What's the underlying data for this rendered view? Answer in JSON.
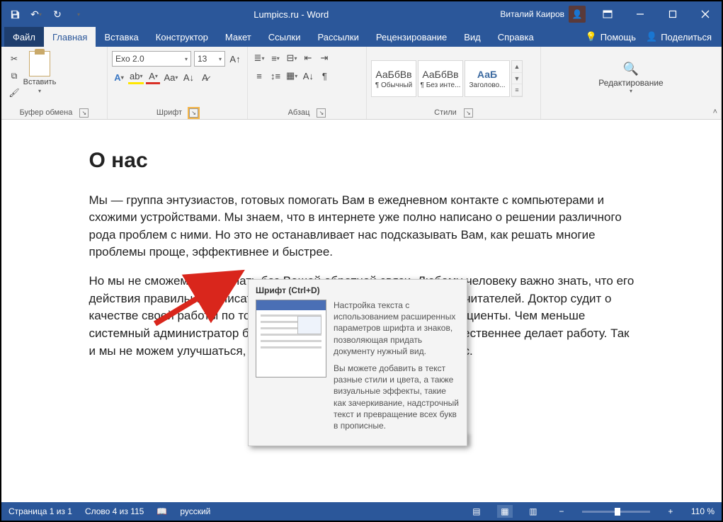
{
  "titlebar": {
    "doc_title": "Lumpics.ru  -  Word",
    "user_name": "Виталий Каиров"
  },
  "tabs": {
    "file": "Файл",
    "items": [
      "Главная",
      "Вставка",
      "Конструктор",
      "Макет",
      "Ссылки",
      "Рассылки",
      "Рецензирование",
      "Вид",
      "Справка"
    ],
    "help": "Помощь",
    "share": "Поделиться"
  },
  "ribbon": {
    "clipboard": {
      "paste": "Вставить",
      "label": "Буфер обмена"
    },
    "font": {
      "name": "Exo 2.0",
      "size": "13",
      "label": "Шрифт"
    },
    "paragraph": {
      "label": "Абзац"
    },
    "styles": {
      "label": "Стили",
      "tiles": [
        {
          "sample": "АаБбВв",
          "name": "¶ Обычный"
        },
        {
          "sample": "АаБбВв",
          "name": "¶ Без инте..."
        },
        {
          "sample": "АаБ",
          "name": "Заголово..."
        }
      ]
    },
    "editing": {
      "label": "Редактирование"
    }
  },
  "tooltip": {
    "title": "Шрифт (Ctrl+D)",
    "p1": "Настройка текста с использованием расширенных параметров шрифта и знаков, позволяющая придать документу нужный вид.",
    "p2": "Вы можете добавить в текст разные стили и цвета, а также визуальные эффекты, такие как зачеркивание, надстрочный текст и превращение всех букв в прописные."
  },
  "document": {
    "heading": "О нас",
    "p1": "Мы — группа энтузиастов, готовых помогать Вам в ежедневном контакте с компьютерами и схожими устройствами. Мы знаем, что в интернете уже полно написано о решении различного рода проблем с ними. Но это не останавливает нас подсказывать Вам, как решать многие проблемы проще, эффективнее и быстрее.",
    "p2": "Но мы не сможем это сделать без Вашей обратной связи. Любому человеку важно знать, что его действия правильные. Писатель судит о своей работе по отзывам читателей. Доктор судит о качестве своей работы по тому, как быстро выздоравливают его пациенты. Чем меньше системный администратор бегает и что-то настраивает, тем он качественнее делает работу. Так и мы не можем улучшаться, если не будем получать ответов от Вас."
  },
  "status": {
    "page": "Страница 1 из 1",
    "words": "Слово 4 из 115",
    "lang": "русский",
    "zoom": "110 %"
  }
}
